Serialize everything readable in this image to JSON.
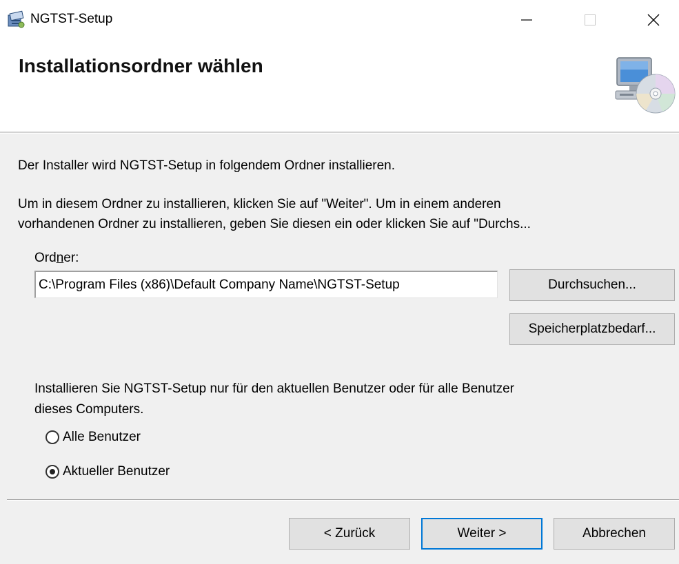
{
  "window": {
    "title": "NGTST-Setup",
    "controls": {
      "minimize": "—",
      "close": "✕"
    }
  },
  "header": {
    "title": "Installationsordner wählen"
  },
  "body": {
    "intro": "Der Installer wird NGTST-Setup in folgendem Ordner installieren.",
    "instruction_line1": "Um in diesem Ordner zu installieren, klicken Sie auf \"Weiter\". Um in einem anderen",
    "instruction_line2": "vorhandenen Ordner zu installieren, geben Sie diesen ein oder klicken Sie auf \"Durchs...",
    "folder_label_pre": "Ord",
    "folder_label_accel": "n",
    "folder_label_post": "er:",
    "folder_value": "C:\\Program Files (x86)\\Default Company Name\\NGTST-Setup",
    "browse_button": "Durchsuchen...",
    "disk_cost_button": "Speicherplatzbedarf...",
    "scope_line1": "Installieren Sie NGTST-Setup nur für den aktuellen Benutzer oder für alle Benutzer",
    "scope_line2": "dieses Computers.",
    "radio_all_label": "Alle Benutzer",
    "radio_current_label": "Aktueller Benutzer",
    "selected_scope": "current"
  },
  "footer": {
    "back_button": "< Zurück",
    "next_button": "Weiter >",
    "cancel_button": "Abbrechen"
  },
  "colors": {
    "body_bg": "#f0f0f0",
    "button_bg": "#e1e1e1",
    "focus_border": "#0078d7"
  },
  "icons": {
    "app": "installer-package-icon",
    "header": "computer-cd-icon"
  }
}
